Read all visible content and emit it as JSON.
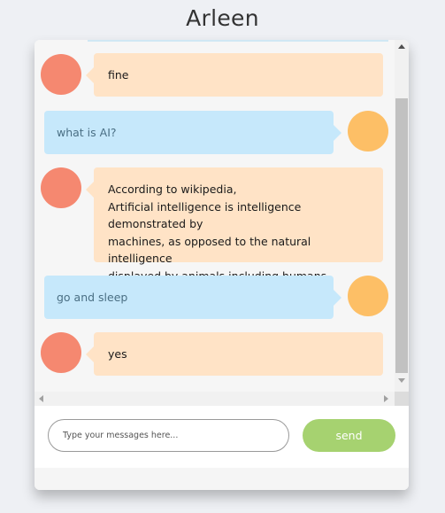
{
  "header": {
    "title": "Arleen"
  },
  "colors": {
    "bot_bubble": "#ffe3c6",
    "user_bubble": "#c6e8fb",
    "bot_avatar": "#f58870",
    "user_avatar": "#fdbf66",
    "send_button": "#a6d270"
  },
  "messages": [
    {
      "sender": "bot",
      "lines": [
        "fine"
      ]
    },
    {
      "sender": "user",
      "lines": [
        "what is AI?"
      ]
    },
    {
      "sender": "bot",
      "lines": [
        "According to wikipedia,",
        "Artificial intelligence is intelligence demonstrated by",
        "machines, as opposed to the natural intelligence",
        "displayed by animals including humans."
      ]
    },
    {
      "sender": "user",
      "lines": [
        "go and sleep"
      ]
    },
    {
      "sender": "bot",
      "lines": [
        "yes"
      ]
    }
  ],
  "composer": {
    "placeholder": "Type your messages here...",
    "value": "",
    "send_label": "send"
  }
}
